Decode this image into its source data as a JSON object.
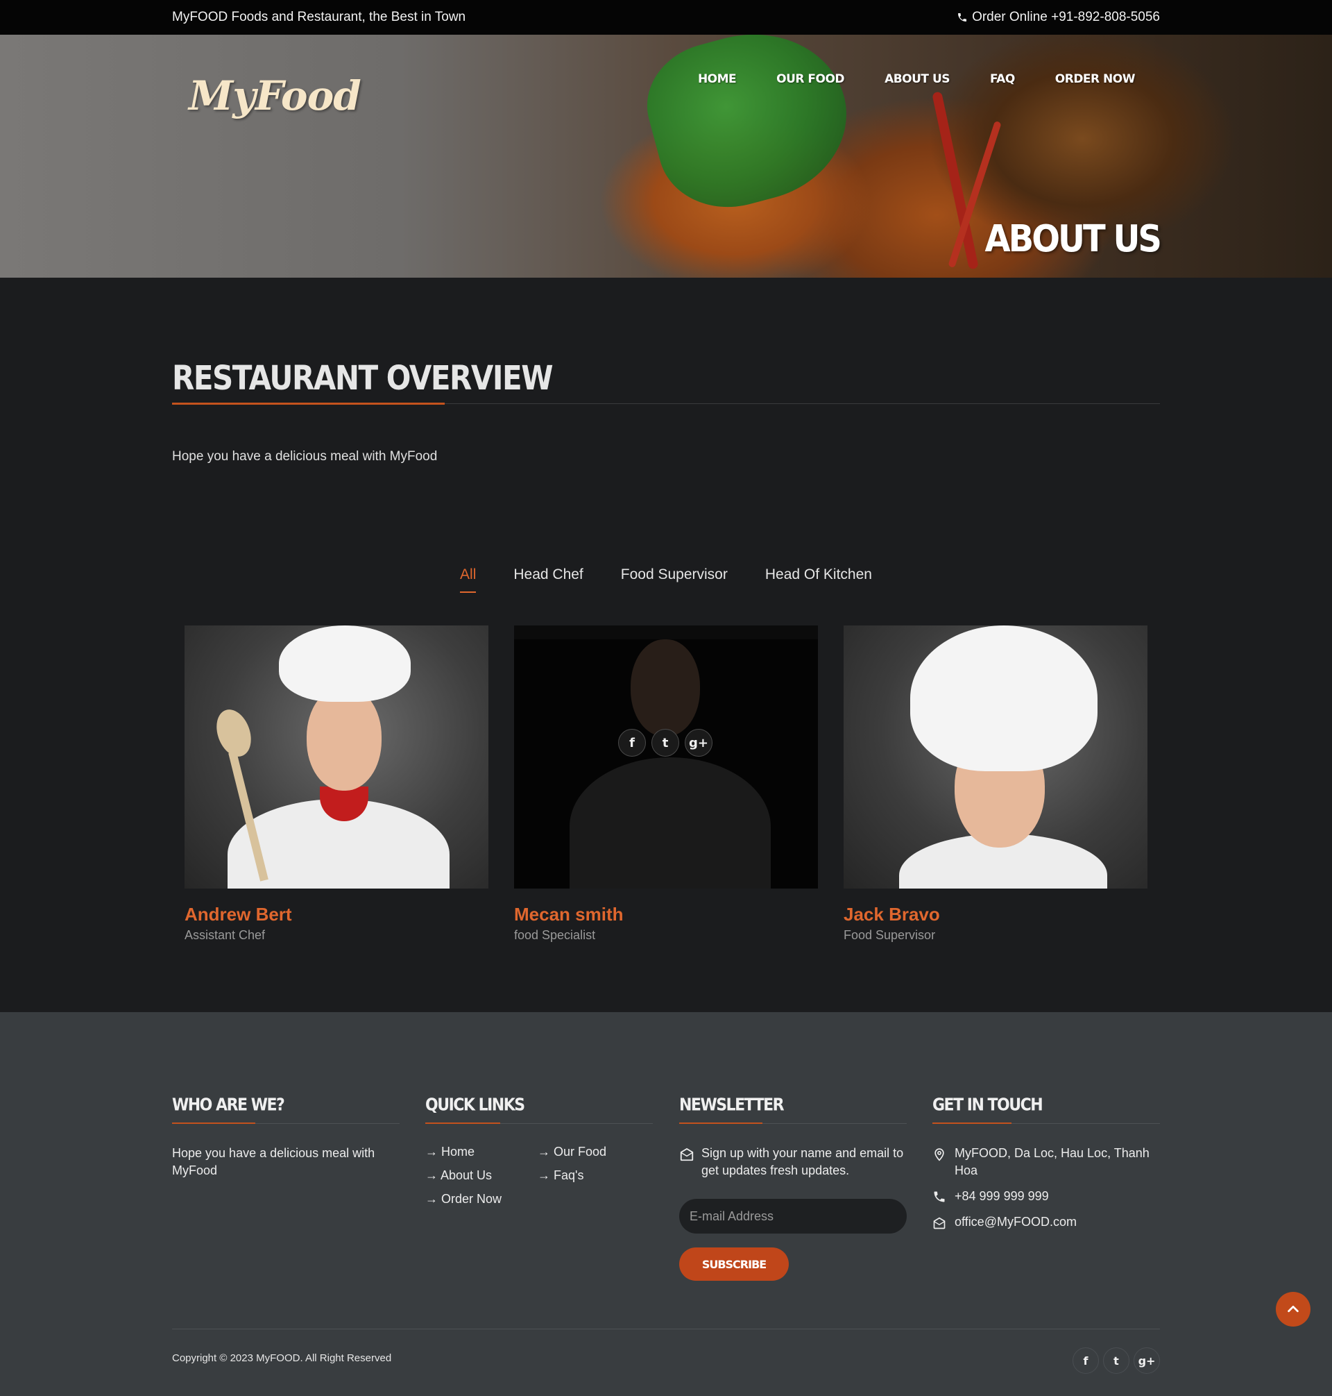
{
  "topbar": {
    "tagline": "MyFOOD Foods and Restaurant, the Best in Town",
    "order_label": "Order Online +91-892-808-5056"
  },
  "header": {
    "logo_text": "MyFood",
    "nav": [
      "HOME",
      "OUR FOOD",
      "ABOUT US",
      "FAQ",
      "ORDER NOW"
    ],
    "page_heading": "ABOUT US"
  },
  "overview": {
    "title": "RESTAURANT OVERVIEW",
    "text": "Hope you have a delicious meal with MyFood"
  },
  "filters": {
    "items": [
      "All",
      "Head Chef",
      "Food Supervisor",
      "Head Of Kitchen"
    ],
    "active": "All"
  },
  "team": [
    {
      "name": "Andrew Bert",
      "role": "Assistant Chef"
    },
    {
      "name": "Mecan smith",
      "role": "food Specialist"
    },
    {
      "name": "Jack Bravo",
      "role": "Food Supervisor"
    }
  ],
  "footer": {
    "who": {
      "title": "WHO ARE WE?",
      "text": "Hope you have a delicious meal with MyFood"
    },
    "quick_links": {
      "title": "QUICK LINKS",
      "items": [
        "Home",
        "Our Food",
        "About Us",
        "Faq's",
        "Order Now"
      ]
    },
    "newsletter": {
      "title": "NEWSLETTER",
      "text": "Sign up with your name and email to get updates fresh updates.",
      "placeholder": "E-mail Address",
      "button": "SUBSCRIBE"
    },
    "contact": {
      "title": "GET IN TOUCH",
      "address": "MyFOOD, Da Loc, Hau Loc, Thanh Hoa",
      "phone": "+84 999 999 999",
      "email": "office@MyFOOD.com"
    },
    "copyright": "Copyright © 2023 MyFOOD. All Right Reserved"
  },
  "social_icons": [
    "facebook-icon",
    "twitter-icon",
    "google-plus-icon"
  ],
  "colors": {
    "accent": "#e0672e",
    "button": "#c0461a",
    "page_bg": "#1b1c1e",
    "footer_bg": "#393d40",
    "topbar_bg": "#050505"
  }
}
